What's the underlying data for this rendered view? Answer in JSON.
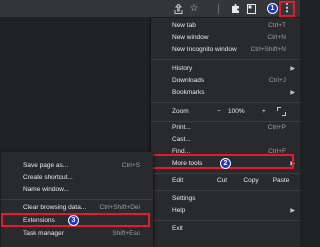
{
  "toolbar": {
    "menu_icon": "⋮",
    "icons": [
      "share-icon",
      "bookmark-star-icon",
      "extensions-puzzle-icon",
      "tab-search-icon"
    ]
  },
  "badges": {
    "step1": "1",
    "step2": "2",
    "step3": "3"
  },
  "colors": {
    "highlight": "#e8192c",
    "badge": "#1f35c8",
    "menu_bg": "#292a2d",
    "page_bg": "#202124"
  },
  "main_menu": {
    "new_tab": {
      "label": "New tab",
      "shortcut": "Ctrl+T"
    },
    "new_window": {
      "label": "New window",
      "shortcut": "Ctrl+N"
    },
    "new_incognito": {
      "label": "New Incognito window",
      "shortcut": "Ctrl+Shift+N"
    },
    "history": {
      "label": "History"
    },
    "downloads": {
      "label": "Downloads",
      "shortcut": "Ctrl+J"
    },
    "bookmarks": {
      "label": "Bookmarks"
    },
    "zoom": {
      "label": "Zoom",
      "minus": "−",
      "level": "100%",
      "plus": "+"
    },
    "print": {
      "label": "Print...",
      "shortcut": "Ctrl+P"
    },
    "cast": {
      "label": "Cast..."
    },
    "find": {
      "label": "Find...",
      "shortcut": "Ctrl+F"
    },
    "more_tools": {
      "label": "More tools"
    },
    "edit": {
      "label": "Edit",
      "cut": "Cut",
      "copy": "Copy",
      "paste": "Paste"
    },
    "settings": {
      "label": "Settings"
    },
    "help": {
      "label": "Help"
    },
    "exit": {
      "label": "Exit"
    }
  },
  "sub_menu": {
    "save_page": {
      "label": "Save page as...",
      "shortcut": "Ctrl+S"
    },
    "create_shortcut": {
      "label": "Create shortcut..."
    },
    "name_window": {
      "label": "Name window..."
    },
    "clear_browsing": {
      "label": "Clear browsing data...",
      "shortcut": "Ctrl+Shift+Del"
    },
    "extensions": {
      "label": "Extensions"
    },
    "task_manager": {
      "label": "Task manager",
      "shortcut": "Shift+Esc"
    }
  }
}
